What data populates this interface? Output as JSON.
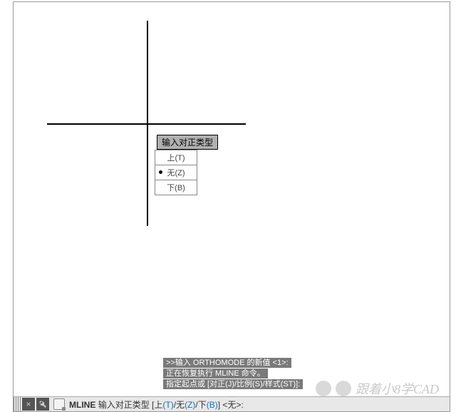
{
  "tooltip": {
    "label": "输入对正类型"
  },
  "menu": {
    "items": [
      {
        "label": "上(T)",
        "selected": false
      },
      {
        "label": "无(Z)",
        "selected": true
      },
      {
        "label": "下(B)",
        "selected": false
      }
    ]
  },
  "history": {
    "lines": [
      ">>输入 ORTHOMODE 的新值 <1>:",
      "正在恢复执行 MLINE 命令。",
      "指定起点或 [对正(J)/比例(S)/样式(ST)]:"
    ]
  },
  "command": {
    "name": "MLINE",
    "prompt_prefix": "输入对正类型 [",
    "opt_top": "上",
    "opt_top_key": "(T)",
    "opt_none": "无",
    "opt_none_key": "(Z)",
    "opt_bottom": "下",
    "opt_bottom_key": "(B)",
    "prompt_suffix": "] <无>:"
  },
  "watermark": {
    "text": "跟着小8学CAD"
  },
  "icons": {
    "close": "×"
  }
}
